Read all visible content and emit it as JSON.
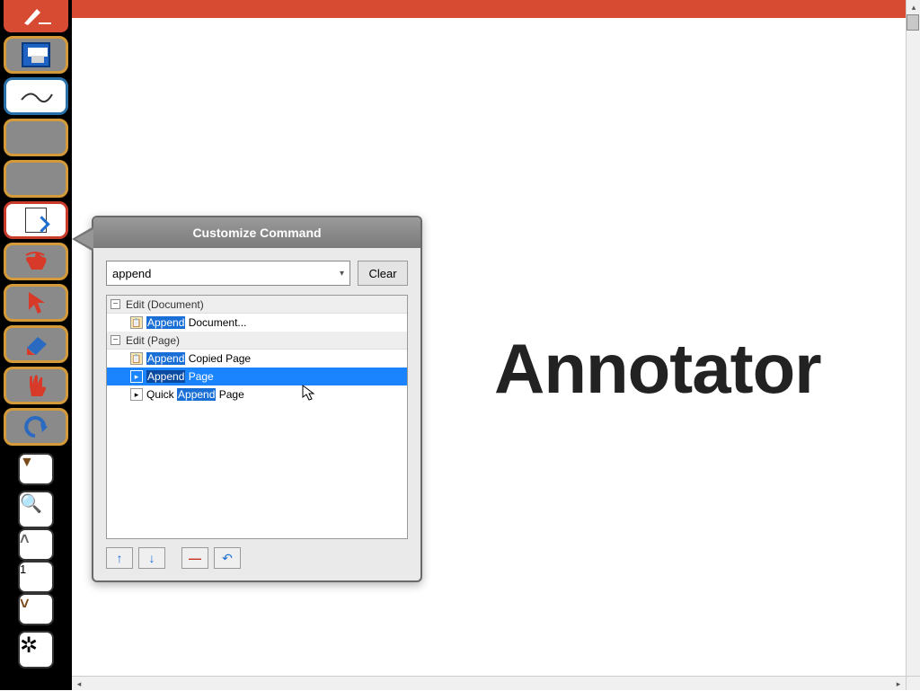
{
  "app_title_fragment": "Annotator",
  "toolbar": {
    "buttons": [
      {
        "name": "app-logo",
        "style": "red-fill"
      },
      {
        "name": "save",
        "style": "orange"
      },
      {
        "name": "freehand",
        "style": "blue-brd"
      },
      {
        "name": "slot-a",
        "style": "orange"
      },
      {
        "name": "slot-b",
        "style": "orange"
      },
      {
        "name": "append-page",
        "style": "red-brd"
      },
      {
        "name": "hand-swipe",
        "style": "orange"
      },
      {
        "name": "pointer",
        "style": "orange"
      },
      {
        "name": "eraser",
        "style": "orange"
      },
      {
        "name": "hand-stop",
        "style": "orange"
      },
      {
        "name": "undo",
        "style": "orange"
      }
    ],
    "nav": {
      "down": "▼",
      "zoom": "🔍",
      "prev": "˄",
      "page": "1",
      "next": "˅",
      "settings": "⚙"
    }
  },
  "popup": {
    "title": "Customize Command",
    "search_value": "append",
    "clear_label": "Clear",
    "groups": [
      {
        "label": "Edit (Document)",
        "items": [
          {
            "pre": "",
            "match": "Append",
            "post": " Document...",
            "icon": "paste",
            "selected": false
          }
        ]
      },
      {
        "label": "Edit (Page)",
        "items": [
          {
            "pre": "",
            "match": "Append",
            "post": " Copied Page",
            "icon": "paste",
            "selected": false
          },
          {
            "pre": "",
            "match": "Append",
            "post": " Page",
            "icon": "page",
            "selected": true
          },
          {
            "pre": "Quick ",
            "match": "Append",
            "post": " Page",
            "icon": "page",
            "selected": false
          }
        ]
      }
    ],
    "footer": {
      "up": "↑",
      "down": "↓",
      "remove": "—",
      "reset": "↶"
    }
  }
}
